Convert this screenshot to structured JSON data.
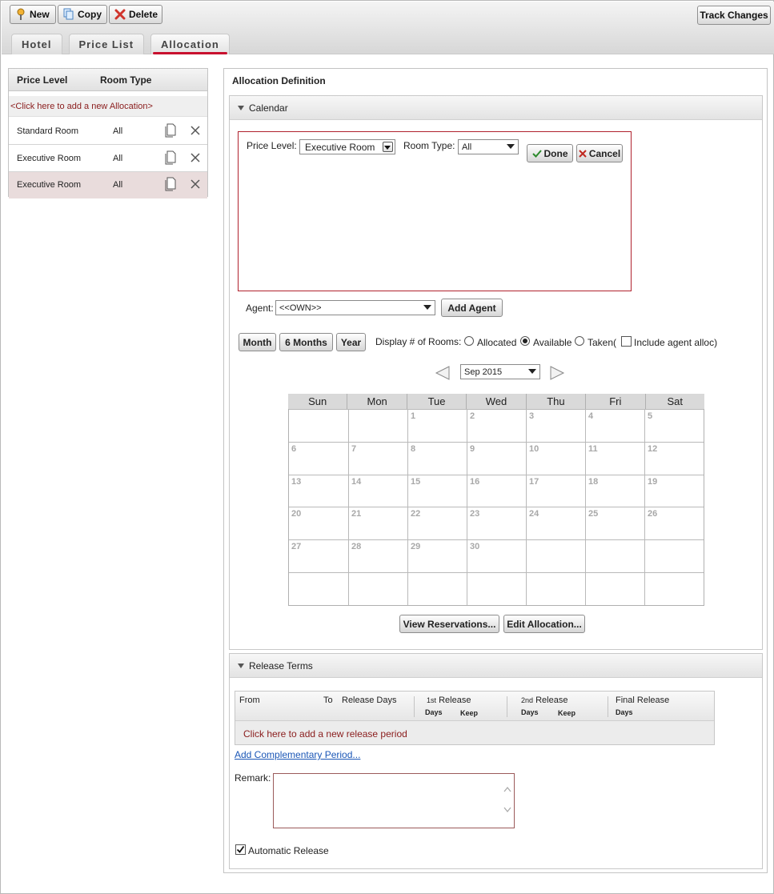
{
  "toolbar": {
    "new_label": "New",
    "copy_label": "Copy",
    "delete_label": "Delete",
    "track_changes_label": "Track Changes"
  },
  "tabs": [
    {
      "label": "Hotel"
    },
    {
      "label": "Price List"
    },
    {
      "label": "Allocation",
      "active": true
    }
  ],
  "left_panel": {
    "col_price_level": "Price Level",
    "col_room_type": "Room Type",
    "add_text": "<Click here to add a new Allocation>",
    "rows": [
      {
        "price_level": "Standard Room",
        "room_type": "All"
      },
      {
        "price_level": "Executive Room",
        "room_type": "All"
      },
      {
        "price_level": "Executive Room",
        "room_type": "All",
        "selected": true
      }
    ]
  },
  "right_panel": {
    "title": "Allocation Definition",
    "calendar_section": {
      "title": "Calendar",
      "price_level_label": "Price Level:",
      "price_level_value": "Executive Room",
      "room_type_label": "Room Type:",
      "room_type_value": "All",
      "done_label": "Done",
      "cancel_label": "Cancel",
      "agent_label": "Agent:",
      "agent_value": "<<OWN>>",
      "add_agent_label": "Add Agent",
      "view_buttons": [
        "Month",
        "6 Months",
        "Year"
      ],
      "display_label": "Display # of Rooms:",
      "radio_allocated": "Allocated",
      "radio_available": "Available",
      "radio_taken": "Taken(",
      "include_agent_label": "Include agent alloc)",
      "month_value": "Sep 2015",
      "weekdays": [
        "Sun",
        "Mon",
        "Tue",
        "Wed",
        "Thu",
        "Fri",
        "Sat"
      ],
      "days": [
        "",
        "",
        "1",
        "2",
        "3",
        "4",
        "5",
        "6",
        "7",
        "8",
        "9",
        "10",
        "11",
        "12",
        "13",
        "14",
        "15",
        "16",
        "17",
        "18",
        "19",
        "20",
        "21",
        "22",
        "23",
        "24",
        "25",
        "26",
        "27",
        "28",
        "29",
        "30",
        "",
        "",
        "",
        "",
        "",
        "",
        "",
        "",
        "",
        ""
      ],
      "view_reservations_label": "View Reservations...",
      "edit_allocation_label": "Edit Allocation..."
    },
    "release_section": {
      "title": "Release Terms",
      "col_from": "From",
      "col_to": "To",
      "col_release_days": "Release Days",
      "col_1st_prefix": "1st",
      "col_release": "Release",
      "col_2nd_prefix": "2nd",
      "col_final_release": "Final Release",
      "sub_days": "Days",
      "sub_keep": "Keep",
      "add_period_text": "Click here to add a new release period",
      "add_complementary_label": "Add Complementary Period...",
      "remark_label": "Remark:",
      "automatic_release_label": "Automatic Release"
    }
  }
}
